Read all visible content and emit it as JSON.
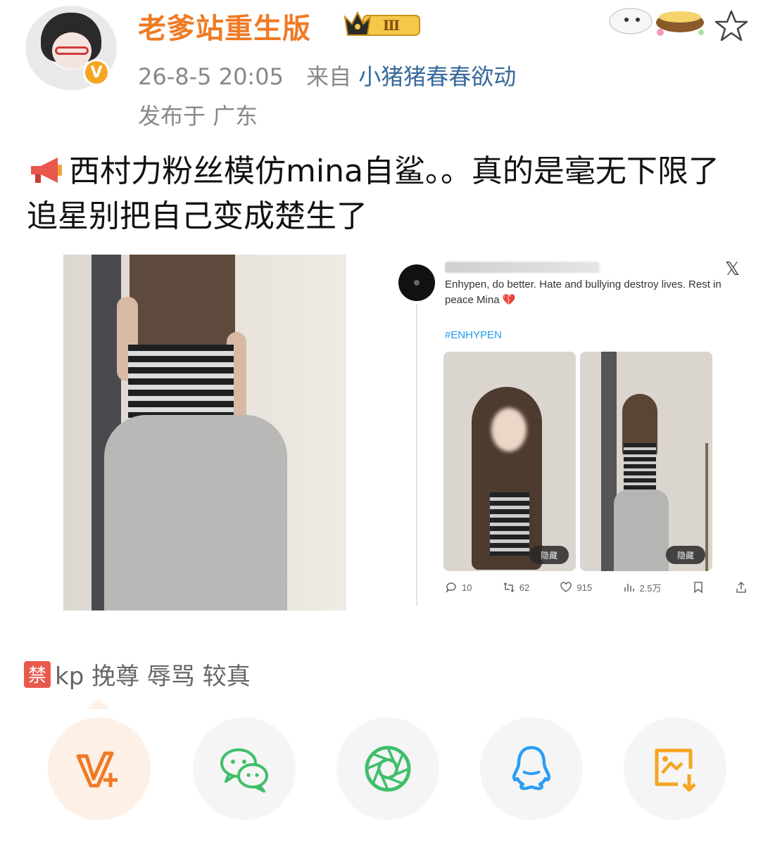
{
  "post": {
    "username": "老爹站重生版",
    "badge_level": "Ⅲ",
    "time": "26-8-5 20:05",
    "from_label": "来自",
    "source": "小猪猪春春欲动",
    "location": "发布于 广东",
    "text": "西村力粉丝模仿mina自鲨。。真的是毫无下限了 追星别把自己变成楚生了"
  },
  "tweet": {
    "text": "Enhypen, do better. Hate and bullying destroy lives. Rest in peace Mina 💔",
    "hashtag": "#ENHYPEN",
    "image_label": "隐藏",
    "stats": {
      "replies": "10",
      "retweets": "62",
      "likes": "915",
      "views": "2.5万"
    }
  },
  "tags": {
    "ban_icon": "禁",
    "text": "kp 挽尊 辱骂 较真"
  },
  "share": {
    "items": [
      "vplus",
      "wechat",
      "moments",
      "qq",
      "save-image"
    ]
  },
  "colors": {
    "username": "#f07a24",
    "source_link": "#36699b",
    "wechat_green": "#3fbf6a",
    "qq_blue": "#2a9df4",
    "save_orange": "#f5a623"
  }
}
